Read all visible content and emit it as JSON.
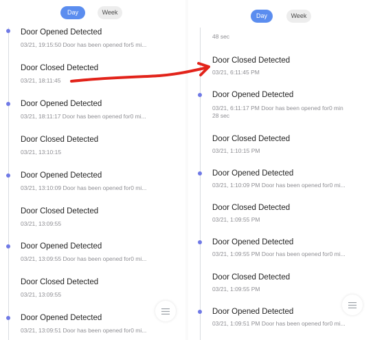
{
  "left": {
    "tabs": {
      "day": "Day",
      "week": "Week"
    },
    "events": [
      {
        "title": "Door Opened Detected",
        "subtitle": "03/21, 19:15:50 Door has been opened for5 mi..."
      },
      {
        "title": "Door Closed Detected",
        "subtitle": "03/21, 18:11:45"
      },
      {
        "title": "Door Opened Detected",
        "subtitle": "03/21, 18:11:17 Door has been opened for0 mi..."
      },
      {
        "title": "Door Closed Detected",
        "subtitle": "03/21, 13:10:15"
      },
      {
        "title": "Door Opened Detected",
        "subtitle": "03/21, 13:10:09 Door has been opened for0 mi..."
      },
      {
        "title": "Door Closed Detected",
        "subtitle": "03/21, 13:09:55"
      },
      {
        "title": "Door Opened Detected",
        "subtitle": "03/21, 13:09:55 Door has been opened for0 mi..."
      },
      {
        "title": "Door Closed Detected",
        "subtitle": "03/21, 13:09:55"
      },
      {
        "title": "Door Opened Detected",
        "subtitle": "03/21, 13:09:51 Door has been opened for0 mi..."
      }
    ]
  },
  "right": {
    "tabs": {
      "day": "Day",
      "week": "Week"
    },
    "top_fragment": "48 sec",
    "events": [
      {
        "title": "Door Closed Detected",
        "subtitle": "03/21, 6:11:45 PM"
      },
      {
        "title": "Door Opened Detected",
        "subtitle": "03/21, 6:11:17 PM Door has been opened for0 min",
        "subtitle2": "28 sec"
      },
      {
        "title": "Door Closed Detected",
        "subtitle": "03/21, 1:10:15 PM"
      },
      {
        "title": "Door Opened Detected",
        "subtitle": "03/21, 1:10:09 PM Door has been opened for0 mi..."
      },
      {
        "title": "Door Closed Detected",
        "subtitle": "03/21, 1:09:55 PM"
      },
      {
        "title": "Door Opened Detected",
        "subtitle": "03/21, 1:09:55 PM Door has been opened for0 mi..."
      },
      {
        "title": "Door Closed Detected",
        "subtitle": "03/21, 1:09:55 PM"
      },
      {
        "title": "Door Opened Detected",
        "subtitle": "03/21, 1:09:51 PM Door has been opened for0 mi..."
      }
    ]
  },
  "icons": {
    "menu_button": "menu-lines-icon"
  },
  "colors": {
    "accent": "#5b8def",
    "dot": "#6f79e6",
    "annotation": "#e2231a"
  }
}
